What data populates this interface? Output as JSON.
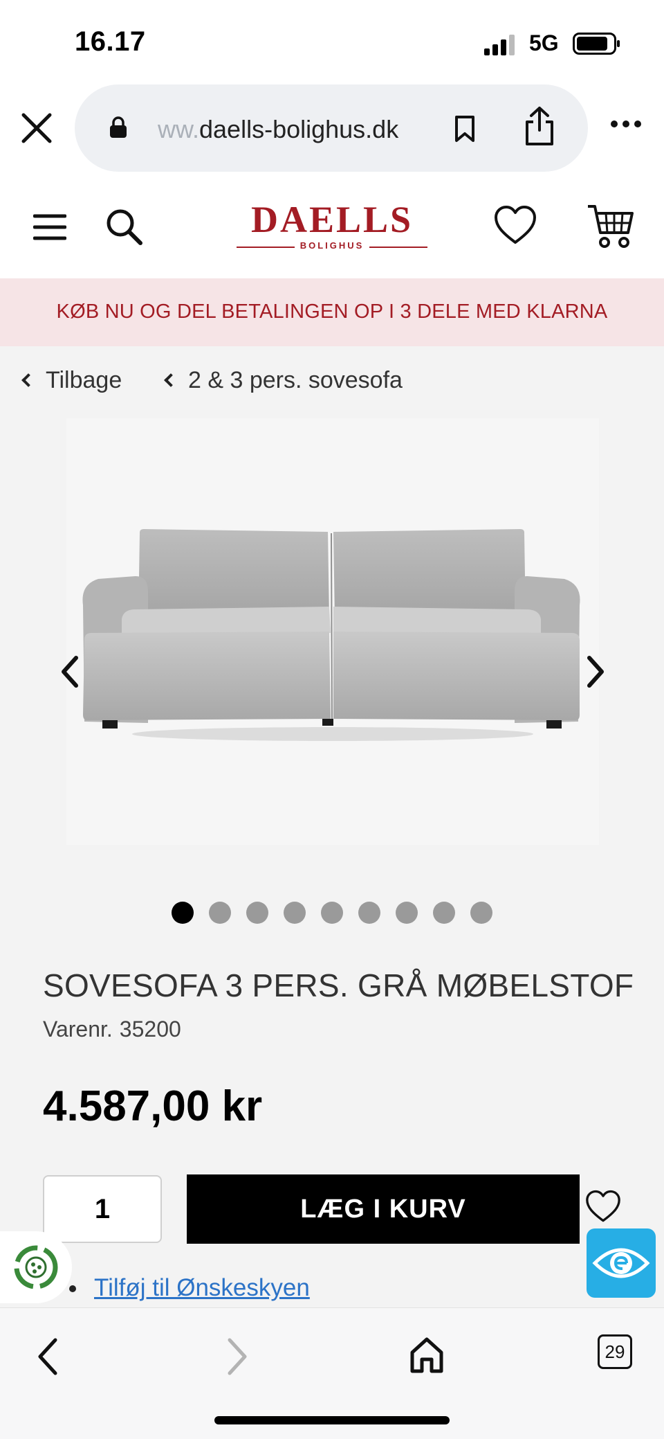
{
  "status_bar": {
    "time": "16.17",
    "network": "5G",
    "signal_icon": "signal-bars-icon",
    "battery_icon": "battery-icon"
  },
  "browser": {
    "url_faded": "ww.",
    "url_main": "daells-bolighus.dk",
    "icons": [
      "close-icon",
      "lock-icon",
      "bookmark-icon",
      "share-icon",
      "more-icon"
    ]
  },
  "header": {
    "logo_name": "DAELLS",
    "logo_sub": "BOLIGHUS",
    "icons": [
      "menu-icon",
      "search-icon",
      "heart-icon",
      "cart-icon"
    ],
    "brand_color": "#a31c24"
  },
  "promo": {
    "text": "KØB NU OG DEL BETALINGEN OP I 3 DELE MED KLARNA",
    "bg_color": "#f6e4e6"
  },
  "breadcrumbs": {
    "back": "Tilbage",
    "category": "2 & 3 pers. sovesofa"
  },
  "gallery": {
    "image_count": 9,
    "active_index": 0
  },
  "product": {
    "title": "SOVESOFA 3 PERS. GRÅ MØBELSTOF",
    "sku_label": "Varenr.",
    "sku": "35200",
    "price": "4.587,00 kr",
    "quantity": "1",
    "add_button": "LÆG I KURV",
    "wishlist_link": "Tilføj til Ønskeskyen"
  },
  "toolbar": {
    "tabs_count": "29",
    "icons": [
      "back-icon",
      "forward-icon",
      "home-icon",
      "tabs-icon"
    ]
  }
}
